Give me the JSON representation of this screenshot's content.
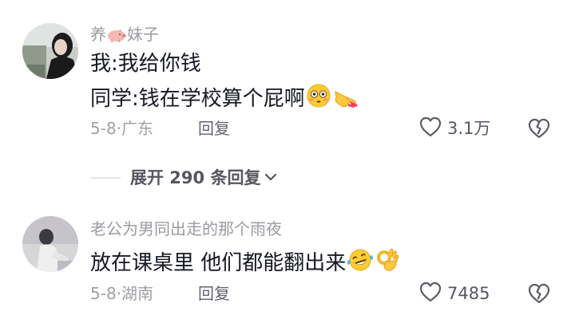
{
  "comments": [
    {
      "username_parts": [
        "养",
        "妹子"
      ],
      "username_emoji": "pig-emoji",
      "lines": [
        "我:我给你钱",
        "同学:钱在学校算个屁啊"
      ],
      "line_emojis": [
        "flushed-face-emoji",
        "pointing-hand-emoji"
      ],
      "date_location": "5-8·广东",
      "reply_label": "回复",
      "like_count": "3.1万"
    },
    {
      "username": "老公为男同出走的那个雨夜",
      "lines": [
        "放在课桌里 他们都能翻出来"
      ],
      "line_emojis": [
        "tears-of-joy-emoji",
        "ok-hand-emoji"
      ],
      "date_location": "5-8·湖南",
      "reply_label": "回复",
      "like_count": "7485"
    }
  ],
  "expand_replies": {
    "label": "展开 290 条回复"
  },
  "colors": {
    "username": "#9b9ba1",
    "body_text": "#161823",
    "meta_text": "#a0a0a6",
    "icon": "#5c5c66"
  }
}
